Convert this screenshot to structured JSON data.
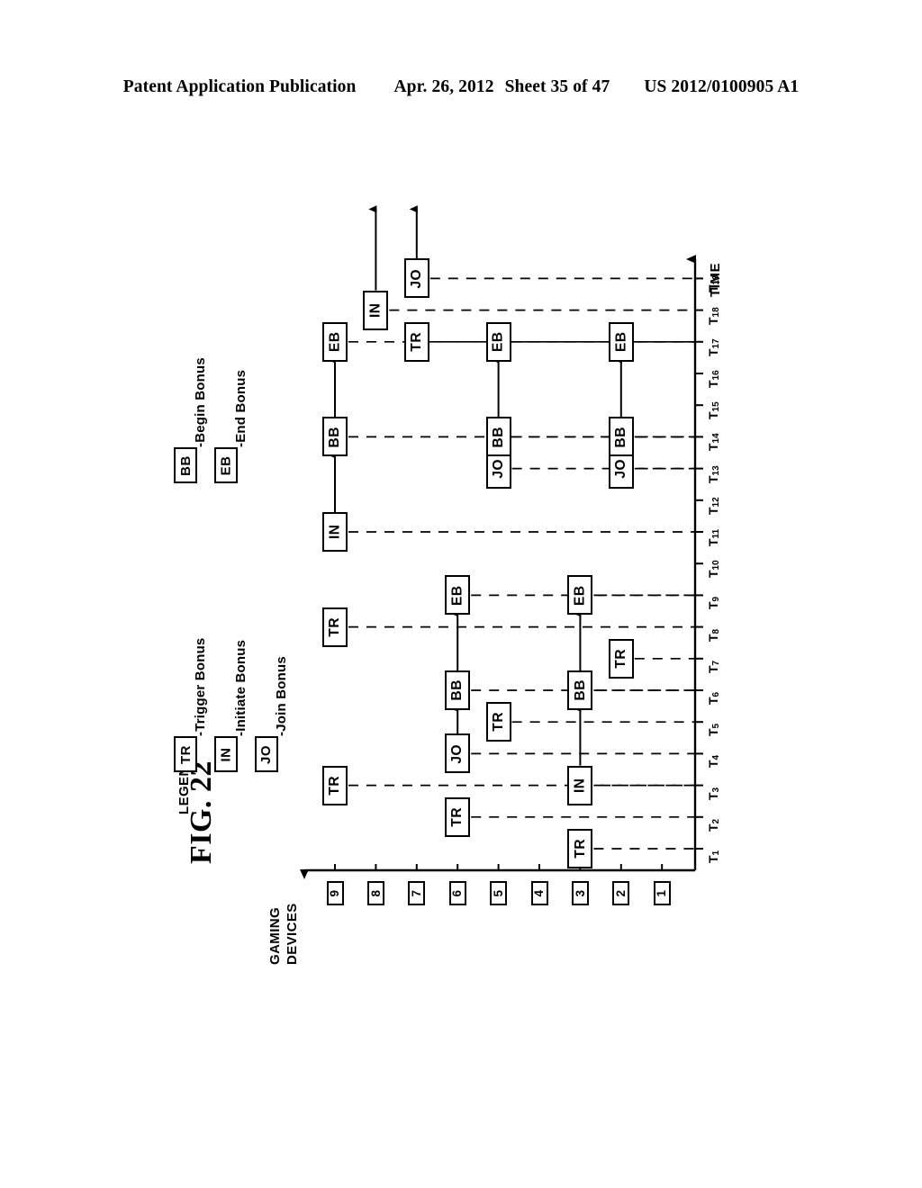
{
  "header": {
    "publication": "Patent Application Publication",
    "date": "Apr. 26, 2012",
    "sheet": "Sheet 35 of 47",
    "doc_number": "US 2012/0100905 A1"
  },
  "figure": {
    "label": "FIG. 22"
  },
  "axes": {
    "y_title_line1": "GAMING",
    "y_title_line2": "DEVICES",
    "x_title": "TIME",
    "devices": [
      "9",
      "8",
      "7",
      "6",
      "5",
      "4",
      "3",
      "2",
      "1"
    ],
    "times": [
      "1",
      "2",
      "3",
      "4",
      "5",
      "6",
      "7",
      "8",
      "9",
      "10",
      "11",
      "12",
      "13",
      "14",
      "15",
      "16",
      "17",
      "18",
      "19"
    ],
    "time_prefix": "T"
  },
  "legend": {
    "title": "LEGEND",
    "items": [
      {
        "code": "TR",
        "text": "-Trigger Bonus"
      },
      {
        "code": "IN",
        "text": "-Initiate Bonus"
      },
      {
        "code": "JO",
        "text": "-Join Bonus"
      },
      {
        "code": "BB",
        "text": "-Begin Bonus"
      },
      {
        "code": "EB",
        "text": "-End Bonus"
      }
    ]
  },
  "chart_data": {
    "type": "scatter",
    "title": "FIG. 22",
    "xlabel": "TIME",
    "ylabel": "GAMING DEVICES",
    "grid": false,
    "legend_position": "left",
    "x": [
      "T1",
      "T2",
      "T3",
      "T4",
      "T5",
      "T6",
      "T7",
      "T8",
      "T9",
      "T10",
      "T11",
      "T12",
      "T13",
      "T14",
      "T15",
      "T16",
      "T17",
      "T18",
      "T19"
    ],
    "categories": [
      "9",
      "8",
      "7",
      "6",
      "5",
      "4",
      "3",
      "2",
      "1"
    ],
    "events": [
      {
        "device": "3",
        "time": "T1",
        "code": "TR"
      },
      {
        "device": "6",
        "time": "T2",
        "code": "TR"
      },
      {
        "device": "9",
        "time": "T3",
        "code": "TR"
      },
      {
        "device": "3",
        "time": "T3",
        "code": "IN"
      },
      {
        "device": "6",
        "time": "T4",
        "code": "JO"
      },
      {
        "device": "5",
        "time": "T5",
        "code": "TR"
      },
      {
        "device": "6",
        "time": "T6",
        "code": "BB"
      },
      {
        "device": "3",
        "time": "T6",
        "code": "BB"
      },
      {
        "device": "2",
        "time": "T7",
        "code": "TR"
      },
      {
        "device": "9",
        "time": "T8",
        "code": "TR"
      },
      {
        "device": "6",
        "time": "T9",
        "code": "EB"
      },
      {
        "device": "3",
        "time": "T9",
        "code": "EB"
      },
      {
        "device": "9",
        "time": "T11",
        "code": "IN"
      },
      {
        "device": "5",
        "time": "T13",
        "code": "JO"
      },
      {
        "device": "2",
        "time": "T13",
        "code": "JO"
      },
      {
        "device": "9",
        "time": "T14",
        "code": "BB"
      },
      {
        "device": "5",
        "time": "T14",
        "code": "BB"
      },
      {
        "device": "2",
        "time": "T14",
        "code": "BB"
      },
      {
        "device": "9",
        "time": "T17",
        "code": "EB"
      },
      {
        "device": "7",
        "time": "T17",
        "code": "TR"
      },
      {
        "device": "5",
        "time": "T17",
        "code": "EB"
      },
      {
        "device": "2",
        "time": "T17",
        "code": "EB"
      },
      {
        "device": "8",
        "time": "T18",
        "code": "IN"
      },
      {
        "device": "7",
        "time": "T19",
        "code": "JO"
      }
    ],
    "flows": [
      {
        "device": "3",
        "from": "T3",
        "to": "T6"
      },
      {
        "device": "3",
        "from": "T6",
        "to": "T9"
      },
      {
        "device": "6",
        "from": "T4",
        "to": "T6"
      },
      {
        "device": "6",
        "from": "T6",
        "to": "T9"
      },
      {
        "device": "9",
        "from": "T11",
        "to": "T14"
      },
      {
        "device": "9",
        "from": "T14",
        "to": "T17"
      },
      {
        "device": "5",
        "from": "T13",
        "to": "T14"
      },
      {
        "device": "5",
        "from": "T14",
        "to": "T17"
      },
      {
        "device": "2",
        "from": "T13",
        "to": "T14"
      },
      {
        "device": "2",
        "from": "T14",
        "to": "T17"
      },
      {
        "device": "8",
        "from": "T18",
        "to": "open"
      },
      {
        "device": "7",
        "from": "T19",
        "to": "open"
      }
    ]
  }
}
